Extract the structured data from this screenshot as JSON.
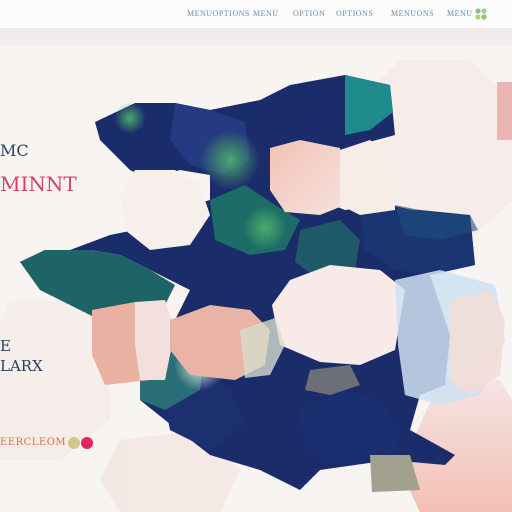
{
  "nav": {
    "items": [
      {
        "label": "MENUOPTIONS"
      },
      {
        "label": "MENU"
      },
      {
        "label": "OPTION"
      },
      {
        "label": "OPTIONS"
      },
      {
        "label": "MENUONS"
      },
      {
        "label": "MENU"
      }
    ],
    "logo_icon": "clover-icon"
  },
  "hero": {
    "line1": "MC",
    "line2": "MINNT",
    "line3": "E",
    "line4": "LARX",
    "cta": "EERCLEOM",
    "dot_colors": [
      "#d9c48a",
      "#e6245c"
    ]
  },
  "colors": {
    "navy": "#1c2f6e",
    "teal": "#1d6a6a",
    "green": "#2f8a4f",
    "peach": "#e8a595",
    "cream": "#f7ece6",
    "blush": "#f3d6d4",
    "sky": "#c9dbf0",
    "gray": "#8e8c7e"
  }
}
